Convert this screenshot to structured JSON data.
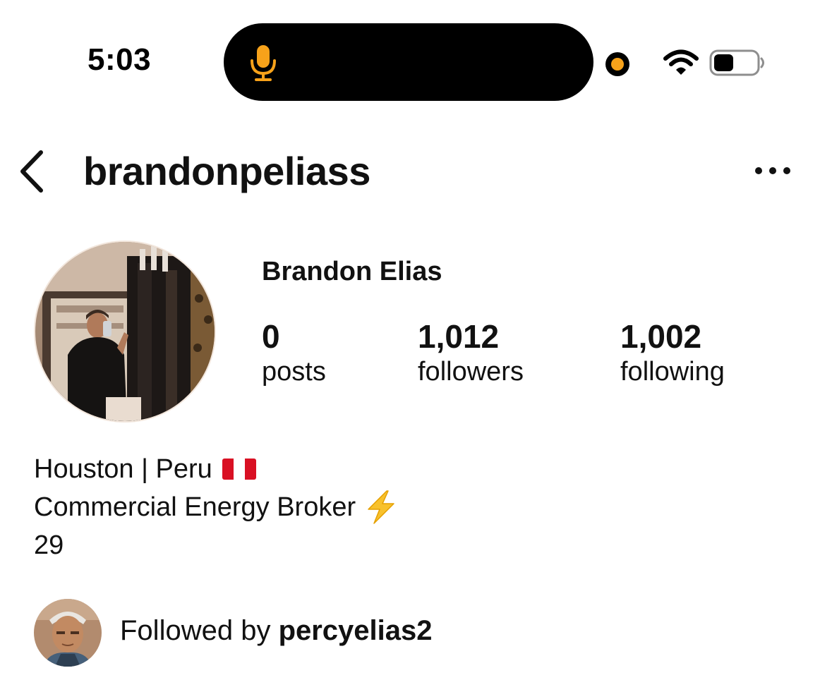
{
  "status_bar": {
    "time": "5:03",
    "mic_color": "#f7a21a",
    "icons": [
      "mic-icon",
      "recording-dot-icon",
      "wifi-icon",
      "battery-icon"
    ]
  },
  "header": {
    "username": "brandonpeliass",
    "back_icon": "chevron-left-icon",
    "more_icon": "more-horizontal-icon"
  },
  "profile": {
    "display_name": "Brandon Elias",
    "stats": [
      {
        "value": "0",
        "label": "posts"
      },
      {
        "value": "1,012",
        "label": "followers"
      },
      {
        "value": "1,002",
        "label": "following"
      }
    ],
    "bio": [
      {
        "text": "Houston | Peru",
        "emoji": "peru-flag-icon"
      },
      {
        "text": "Commercial Energy Broker",
        "emoji": "lightning-icon"
      },
      {
        "text": "29"
      }
    ]
  },
  "followed_by": {
    "prefix": "Followed by",
    "user": "percyelias2"
  }
}
